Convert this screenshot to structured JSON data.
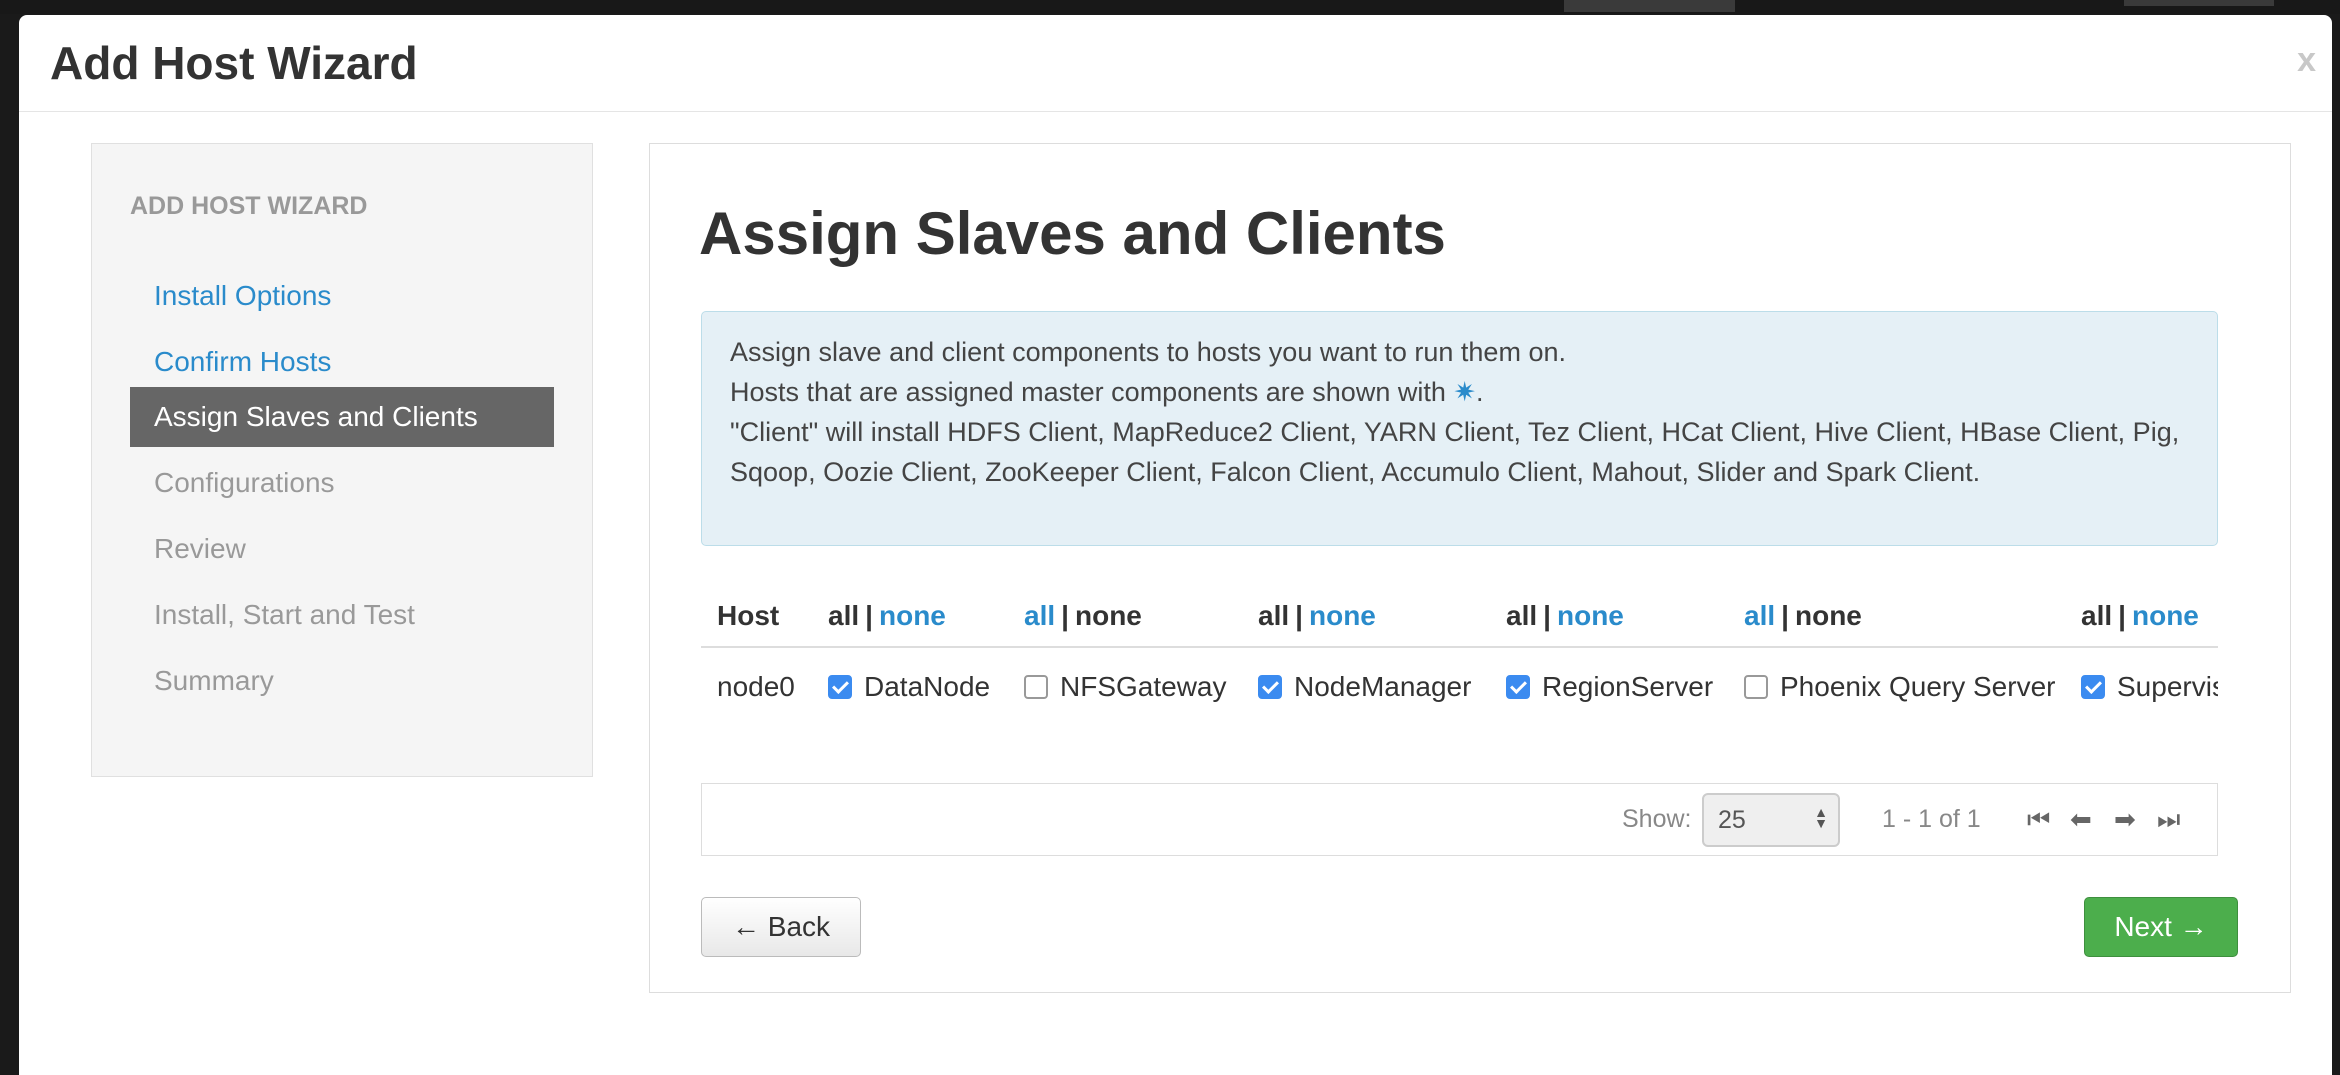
{
  "modal": {
    "title": "Add Host Wizard",
    "close_label": "x"
  },
  "sidebar": {
    "header": "ADD HOST WIZARD",
    "items": [
      {
        "label": "Install Options",
        "state": "link"
      },
      {
        "label": "Confirm Hosts",
        "state": "link"
      },
      {
        "label": "Assign Slaves and Clients",
        "state": "active"
      },
      {
        "label": "Configurations",
        "state": "disabled"
      },
      {
        "label": "Review",
        "state": "disabled"
      },
      {
        "label": "Install, Start and Test",
        "state": "disabled"
      },
      {
        "label": "Summary",
        "state": "disabled"
      }
    ]
  },
  "main": {
    "title": "Assign Slaves and Clients",
    "alert": {
      "line1": "Assign slave and client components to hosts you want to run them on.",
      "line2_prefix": "Hosts that are assigned master components are shown with",
      "line2_star": "✷",
      "line2_suffix": ".",
      "line3": "\"Client\" will install HDFS Client, MapReduce2 Client, YARN Client, Tez Client, HCat Client, Hive Client, HBase Client, Pig, Sqoop, Oozie Client, ZooKeeper Client, Falcon Client, Accumulo Client, Mahout, Slider and Spark Client."
    },
    "grid": {
      "host_header": "Host",
      "all_label": "all",
      "none_label": "none",
      "separator": "|",
      "host": "node0",
      "components": [
        {
          "name": "DataNode",
          "checked": true,
          "all_link": false,
          "none_link": true
        },
        {
          "name": "NFSGateway",
          "checked": false,
          "all_link": true,
          "none_link": false
        },
        {
          "name": "NodeManager",
          "checked": true,
          "all_link": false,
          "none_link": true
        },
        {
          "name": "RegionServer",
          "checked": true,
          "all_link": false,
          "none_link": true
        },
        {
          "name": "Phoenix Query Server",
          "checked": false,
          "all_link": true,
          "none_link": false
        },
        {
          "name": "Supervisor",
          "checked": true,
          "all_link": false,
          "none_link": true
        }
      ]
    },
    "pager": {
      "show_label": "Show:",
      "page_size": "25",
      "info": "1 - 1 of 1"
    },
    "buttons": {
      "back": "← Back",
      "next": "Next →"
    }
  },
  "colors": {
    "link": "#2a8bcb",
    "active_nav_bg": "#666666",
    "alert_bg": "#e5f0f6",
    "checkbox": "#3b8bf0",
    "next_button": "#4cae4c"
  }
}
